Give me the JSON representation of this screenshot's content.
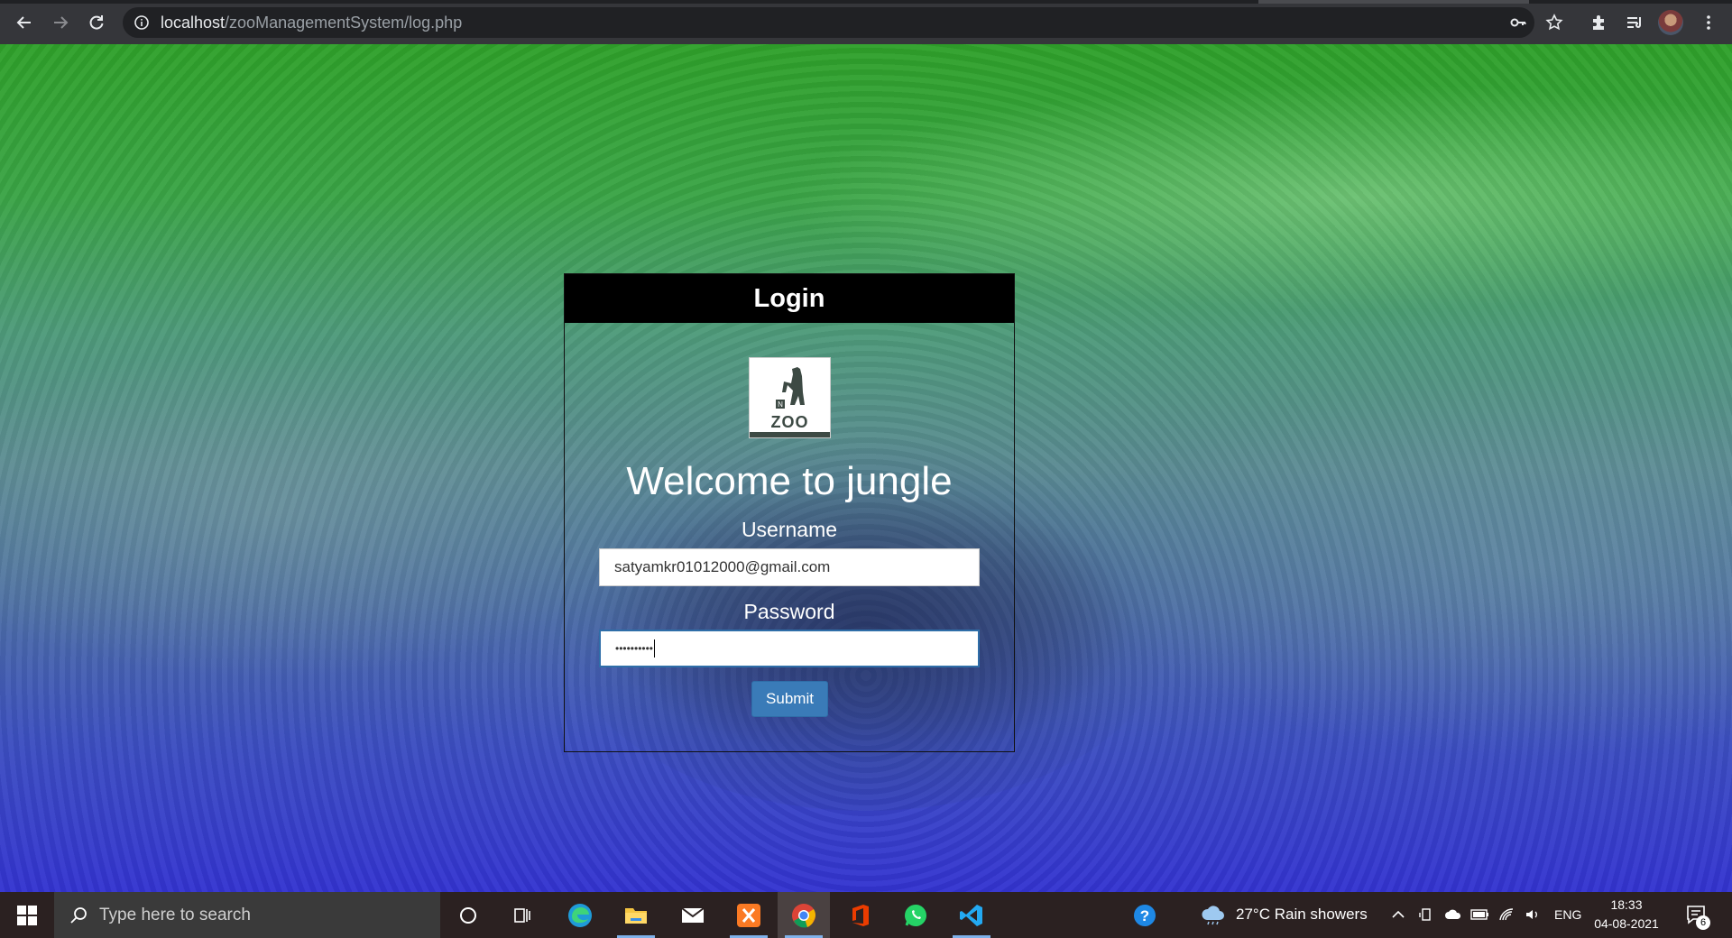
{
  "browser": {
    "url_host": "localhost",
    "url_path": "/zooManagementSystem/log.php"
  },
  "card": {
    "header": "Login",
    "logo_text": "ZOO",
    "welcome": "Welcome to jungle",
    "username_label": "Username",
    "username_value": "satyamkr01012000@gmail.com",
    "password_label": "Password",
    "password_mask": "••••••••••",
    "submit_label": "Submit"
  },
  "taskbar": {
    "search_placeholder": "Type here to search",
    "weather": "27°C  Rain showers",
    "language": "ENG",
    "time": "18:33",
    "date": "04-08-2021",
    "notification_count": "6"
  },
  "colors": {
    "card_header": "#000000",
    "submit": "#3a7bb8",
    "taskbar": "#2b2121"
  }
}
